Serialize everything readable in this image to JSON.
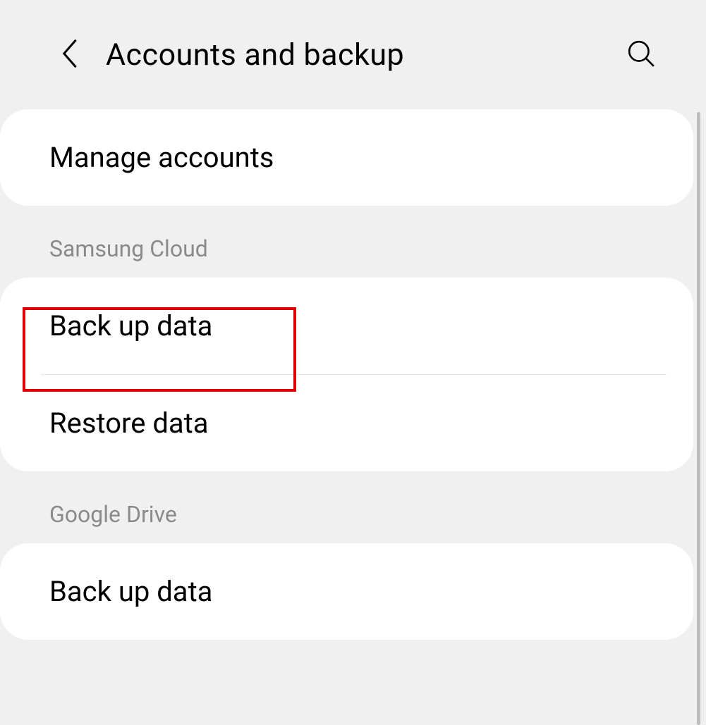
{
  "header": {
    "title": "Accounts and backup"
  },
  "sections": {
    "manage": {
      "label": "Manage accounts"
    },
    "samsung_cloud": {
      "title": "Samsung Cloud",
      "items": [
        {
          "label": "Back up data"
        },
        {
          "label": "Restore data"
        }
      ]
    },
    "google_drive": {
      "title": "Google Drive",
      "items": [
        {
          "label": "Back up data"
        }
      ]
    }
  },
  "highlight": {
    "target": "samsung-cloud-back-up-data"
  }
}
